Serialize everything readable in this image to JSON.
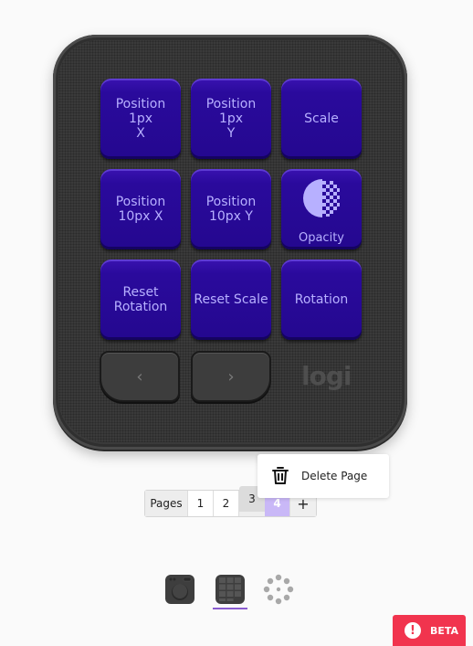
{
  "device": {
    "keys": [
      {
        "label": "Position 1px\nX"
      },
      {
        "label": "Position 1px\nY"
      },
      {
        "label": "Scale"
      },
      {
        "label": "Position\n10px X"
      },
      {
        "label": "Position\n10px Y"
      },
      {
        "label": "Opacity",
        "icon": "opacity-icon"
      },
      {
        "label": "Reset\nRotation"
      },
      {
        "label": "Reset Scale"
      },
      {
        "label": "Rotation"
      }
    ],
    "prev_glyph": "‹",
    "next_glyph": "›",
    "logo": "logi",
    "key_color": "#2a0a9c",
    "key_text_color": "#b7b0ff"
  },
  "pager": {
    "label": "Pages",
    "pages": [
      "1",
      "2",
      "3",
      "4"
    ],
    "hovered_page": "3",
    "active_page": "4",
    "add_label": "+",
    "active_color": "#c9b8f7"
  },
  "context_menu": {
    "items": [
      {
        "label": "Delete Page",
        "icon": "trash-icon"
      }
    ]
  },
  "device_tabs": [
    {
      "name": "dialpad",
      "icon": "dialpad-device-icon"
    },
    {
      "name": "keypad",
      "icon": "keypad-device-icon",
      "selected": true
    },
    {
      "name": "loading",
      "icon": "spinner-icon"
    }
  ],
  "beta_badge": {
    "label": "BETA",
    "icon_glyph": "!",
    "color": "#f1344e"
  }
}
